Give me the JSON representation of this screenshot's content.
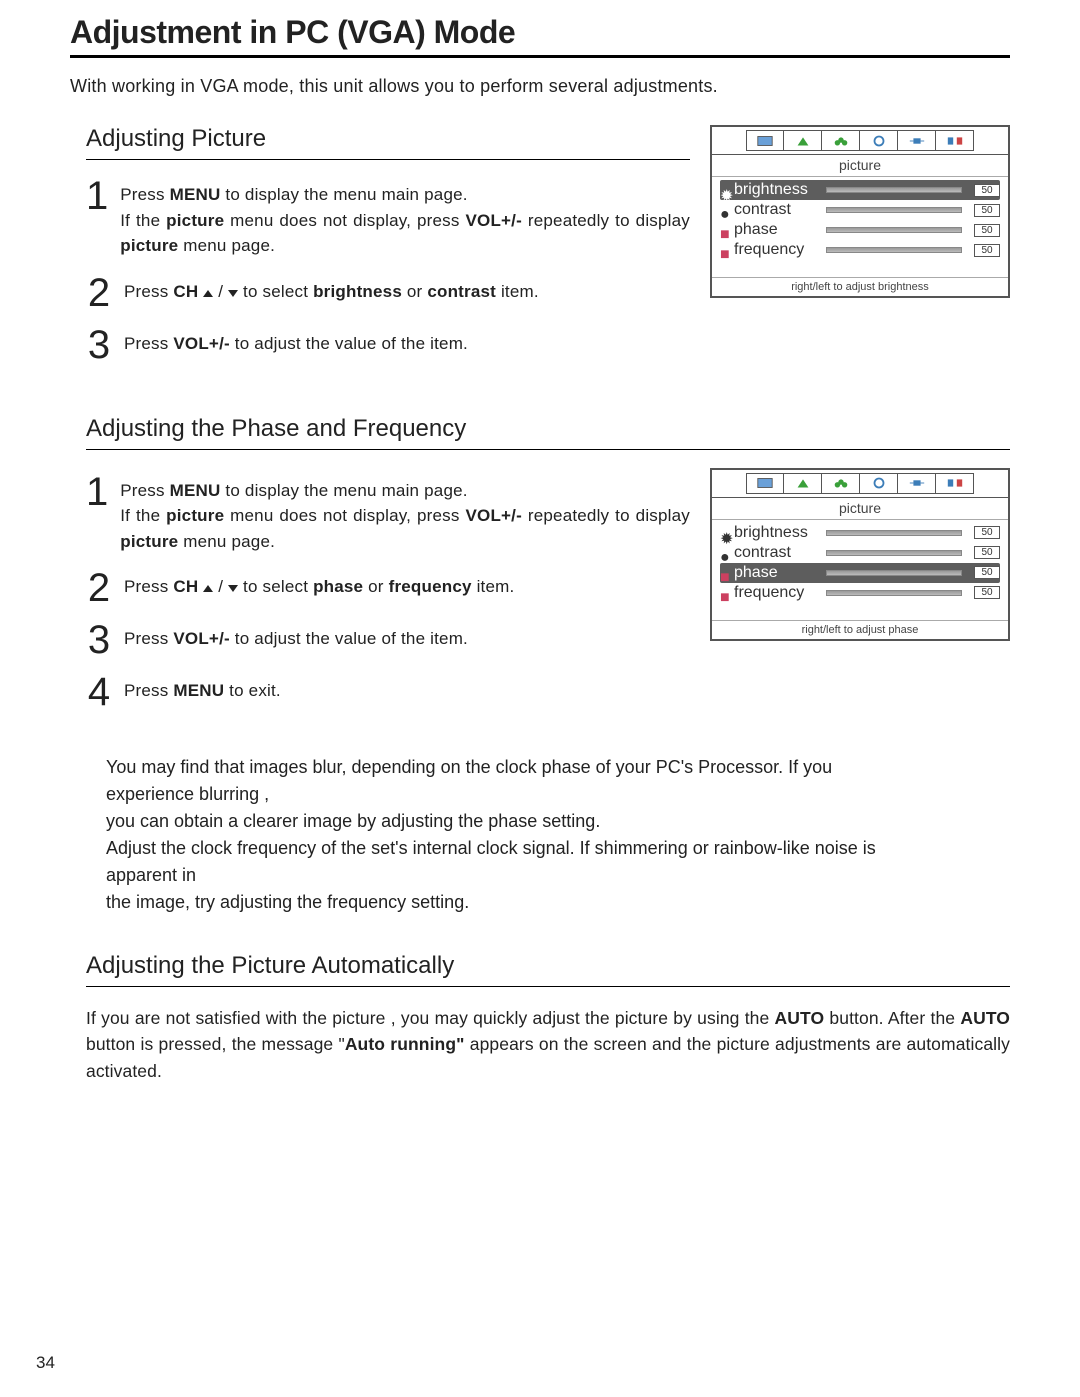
{
  "page_title": "Adjustment in PC (VGA) Mode",
  "intro": "With working in VGA mode, this unit allows you to perform several adjustments.",
  "page_number": "34",
  "sec1": {
    "heading": "Adjusting Picture",
    "step1_a": "Press ",
    "step1_b": "MENU",
    "step1_c": " to display the menu main page.",
    "step1_cont_a": "If the ",
    "step1_cont_b": "picture",
    "step1_cont_c": " menu does not display, press ",
    "step1_cont_d": "VOL+/-",
    "step1_cont_e": " repeatedly to display ",
    "step1_cont_f": "picture",
    "step1_cont_g": " menu page.",
    "step2_a": "Press ",
    "step2_b": "CH",
    "step2_c": " / ",
    "step2_d": " to select ",
    "step2_e": "brightness",
    "step2_f": " or ",
    "step2_g": "contrast",
    "step2_h": " item.",
    "step3_a": "Press ",
    "step3_b": "VOL+/-",
    "step3_c": " to adjust the value of the item."
  },
  "sec2": {
    "heading": "Adjusting the Phase and Frequency",
    "step1_a": "Press ",
    "step1_b": "MENU",
    "step1_c": " to display the menu main page.",
    "step1_cont_a": "If the ",
    "step1_cont_b": "picture",
    "step1_cont_c": " menu does not display, press ",
    "step1_cont_d": "VOL+/-",
    "step1_cont_e": " repeatedly to display ",
    "step1_cont_f": "picture",
    "step1_cont_g": " menu page.",
    "step2_a": "Press ",
    "step2_b": "CH",
    "step2_c": " / ",
    "step2_d": " to select ",
    "step2_e": "phase",
    "step2_f": " or ",
    "step2_g": "frequency",
    "step2_h": " item.",
    "step3_a": "Press ",
    "step3_b": "VOL+/-",
    "step3_c": " to adjust the value of the item.",
    "step4_a": "Press ",
    "step4_b": "MENU",
    "step4_c": " to exit."
  },
  "notes": {
    "l1": "You may find that images blur, depending on the clock phase of your PC's Processor. If you experience blurring ,",
    "l2": "you can obtain a clearer image by adjusting the phase setting.",
    "l3": "Adjust the clock frequency of the set's internal clock signal. If shimmering or rainbow-like noise is apparent in",
    "l4": "the image, try adjusting the frequency setting."
  },
  "sec3": {
    "heading": "Adjusting the Picture Automatically",
    "p_a": "If you are not satisfied with the picture , you may quickly adjust the picture by using the ",
    "p_b": "AUTO",
    "p_c": " button. After the ",
    "p_d": "AUTO",
    "p_e": " button is pressed, the message \"",
    "p_f": "Auto running\"",
    "p_g": " appears on the screen and the picture adjustments are automatically activated."
  },
  "osd": {
    "title": "picture",
    "rows": {
      "brightness": {
        "label": "brightness",
        "value": "50"
      },
      "contrast": {
        "label": "contrast",
        "value": "50"
      },
      "phase": {
        "label": "phase",
        "value": "50"
      },
      "frequency": {
        "label": "frequency",
        "value": "50"
      }
    },
    "foot1": "right/left to adjust brightness",
    "foot2": "right/left to adjust phase"
  },
  "nums": {
    "n1": "1",
    "n2": "2",
    "n3": "3",
    "n4": "4"
  }
}
